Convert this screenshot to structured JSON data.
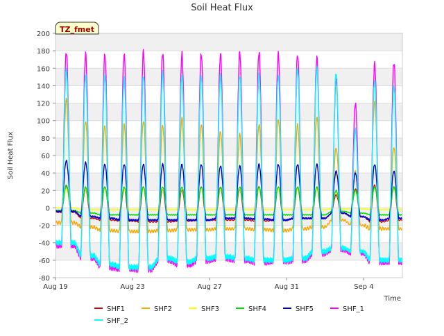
{
  "chart_data": {
    "type": "line",
    "title": "Soil Heat Flux",
    "xlabel": "Time",
    "ylabel": "Soil Heat Flux",
    "badge": "TZ_fmet",
    "x_start": "2024-08-19",
    "x_end": "2024-09-06",
    "x_ticks": [
      {
        "date": "2024-08-19",
        "label": "Aug 19"
      },
      {
        "date": "2024-08-23",
        "label": "Aug 23"
      },
      {
        "date": "2024-08-27",
        "label": "Aug 27"
      },
      {
        "date": "2024-08-31",
        "label": "Aug 31"
      },
      {
        "date": "2024-09-04",
        "label": "Sep 4"
      }
    ],
    "ylim": [
      -80,
      200
    ],
    "y_ticks": [
      -80,
      -60,
      -40,
      -20,
      0,
      20,
      40,
      60,
      80,
      100,
      120,
      140,
      160,
      180,
      200
    ],
    "grid": true,
    "legend_position": "bottom",
    "days": [
      "2024-08-19",
      "2024-08-20",
      "2024-08-21",
      "2024-08-22",
      "2024-08-23",
      "2024-08-24",
      "2024-08-25",
      "2024-08-26",
      "2024-08-27",
      "2024-08-28",
      "2024-08-29",
      "2024-08-30",
      "2024-08-31",
      "2024-09-01",
      "2024-09-02",
      "2024-09-03",
      "2024-09-04",
      "2024-09-05"
    ],
    "series": [
      {
        "name": "SHF1",
        "color": "#dd0000",
        "daily_max": [
          25,
          22,
          24,
          22,
          24,
          22,
          21,
          24,
          23,
          22,
          24,
          24,
          23,
          23,
          15,
          22,
          26,
          24
        ],
        "daily_min": [
          -5,
          -12,
          -14,
          -15,
          -16,
          -16,
          -15,
          -14,
          -14,
          -14,
          -15,
          -14,
          -12,
          -12,
          -6,
          -10,
          -16,
          -14
        ]
      },
      {
        "name": "SHF2",
        "color": "#ffa500",
        "daily_max": [
          124,
          100,
          94,
          95,
          100,
          95,
          102,
          96,
          88,
          84,
          96,
          102,
          95,
          104,
          69,
          42,
          122,
          70
        ],
        "daily_min": [
          -17,
          -22,
          -26,
          -27,
          -27,
          -26,
          -25,
          -25,
          -24,
          -24,
          -25,
          -26,
          -24,
          -22,
          -14,
          -20,
          -24,
          -24
        ]
      },
      {
        "name": "SHF3",
        "color": "#ffff00",
        "daily_max": [
          22,
          22,
          22,
          22,
          22,
          22,
          22,
          22,
          22,
          22,
          22,
          22,
          22,
          22,
          18,
          18,
          22,
          22
        ],
        "daily_min": [
          0,
          -2,
          -2,
          -2,
          -2,
          -2,
          -2,
          -2,
          -2,
          -2,
          -2,
          -2,
          -2,
          -2,
          -1,
          -1,
          -2,
          -2
        ]
      },
      {
        "name": "SHF4",
        "color": "#00dd00",
        "daily_max": [
          26,
          24,
          24,
          24,
          24,
          24,
          24,
          24,
          24,
          24,
          24,
          24,
          24,
          24,
          20,
          20,
          24,
          24
        ],
        "daily_min": [
          -3,
          -6,
          -8,
          -8,
          -8,
          -8,
          -8,
          -8,
          -8,
          -8,
          -8,
          -8,
          -8,
          -8,
          -4,
          -6,
          -8,
          -8
        ]
      },
      {
        "name": "SHF5",
        "color": "#0000cc",
        "daily_max": [
          54,
          52,
          50,
          50,
          50,
          50,
          50,
          50,
          48,
          48,
          50,
          50,
          50,
          50,
          42,
          40,
          50,
          42
        ],
        "daily_min": [
          -4,
          -10,
          -12,
          -14,
          -14,
          -14,
          -14,
          -14,
          -12,
          -12,
          -13,
          -14,
          -12,
          -12,
          -6,
          -10,
          -14,
          -12
        ]
      },
      {
        "name": "SHF_1",
        "color": "#ff00ff",
        "daily_max": [
          179,
          176,
          176,
          176,
          179,
          178,
          176,
          177,
          176,
          178,
          179,
          176,
          176,
          172,
          148,
          120,
          165,
          167
        ],
        "daily_min": [
          -43,
          -57,
          -68,
          -70,
          -70,
          -60,
          -65,
          -60,
          -58,
          -60,
          -62,
          -61,
          -60,
          -52,
          -48,
          -52,
          -62,
          -62
        ]
      },
      {
        "name": "SHF_2",
        "color": "#00ffff",
        "daily_max": [
          158,
          152,
          152,
          148,
          152,
          155,
          152,
          152,
          152,
          152,
          152,
          152,
          160,
          160,
          155,
          90,
          146,
          140
        ],
        "daily_min": [
          -40,
          -55,
          -65,
          -68,
          -68,
          -58,
          -62,
          -58,
          -56,
          -58,
          -60,
          -60,
          -58,
          -50,
          -46,
          -50,
          -60,
          -60
        ]
      }
    ]
  }
}
